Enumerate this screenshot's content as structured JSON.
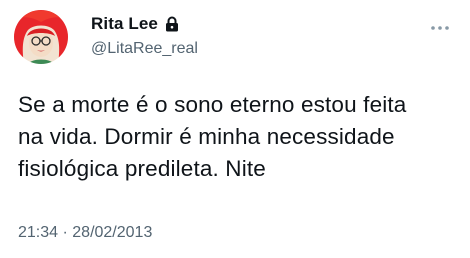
{
  "tweet": {
    "author": {
      "display_name": "Rita Lee",
      "handle": "@LitaRee_real",
      "protected_icon": "lock-icon",
      "avatar_icon": "red-hair-portrait"
    },
    "text_lines": [
      "Se a morte é o sono eterno estou feita",
      "na vida. Dormir é minha necessidade",
      "fisiológica predileta. Nite"
    ],
    "time": "21:34",
    "separator": " · ",
    "date": "28/02/2013",
    "more_icon": "more-horizontal-icon"
  },
  "colors": {
    "text": "#0f1419",
    "secondary": "#536471",
    "background": "#ffffff",
    "avatar_hair": "#e8262b"
  }
}
